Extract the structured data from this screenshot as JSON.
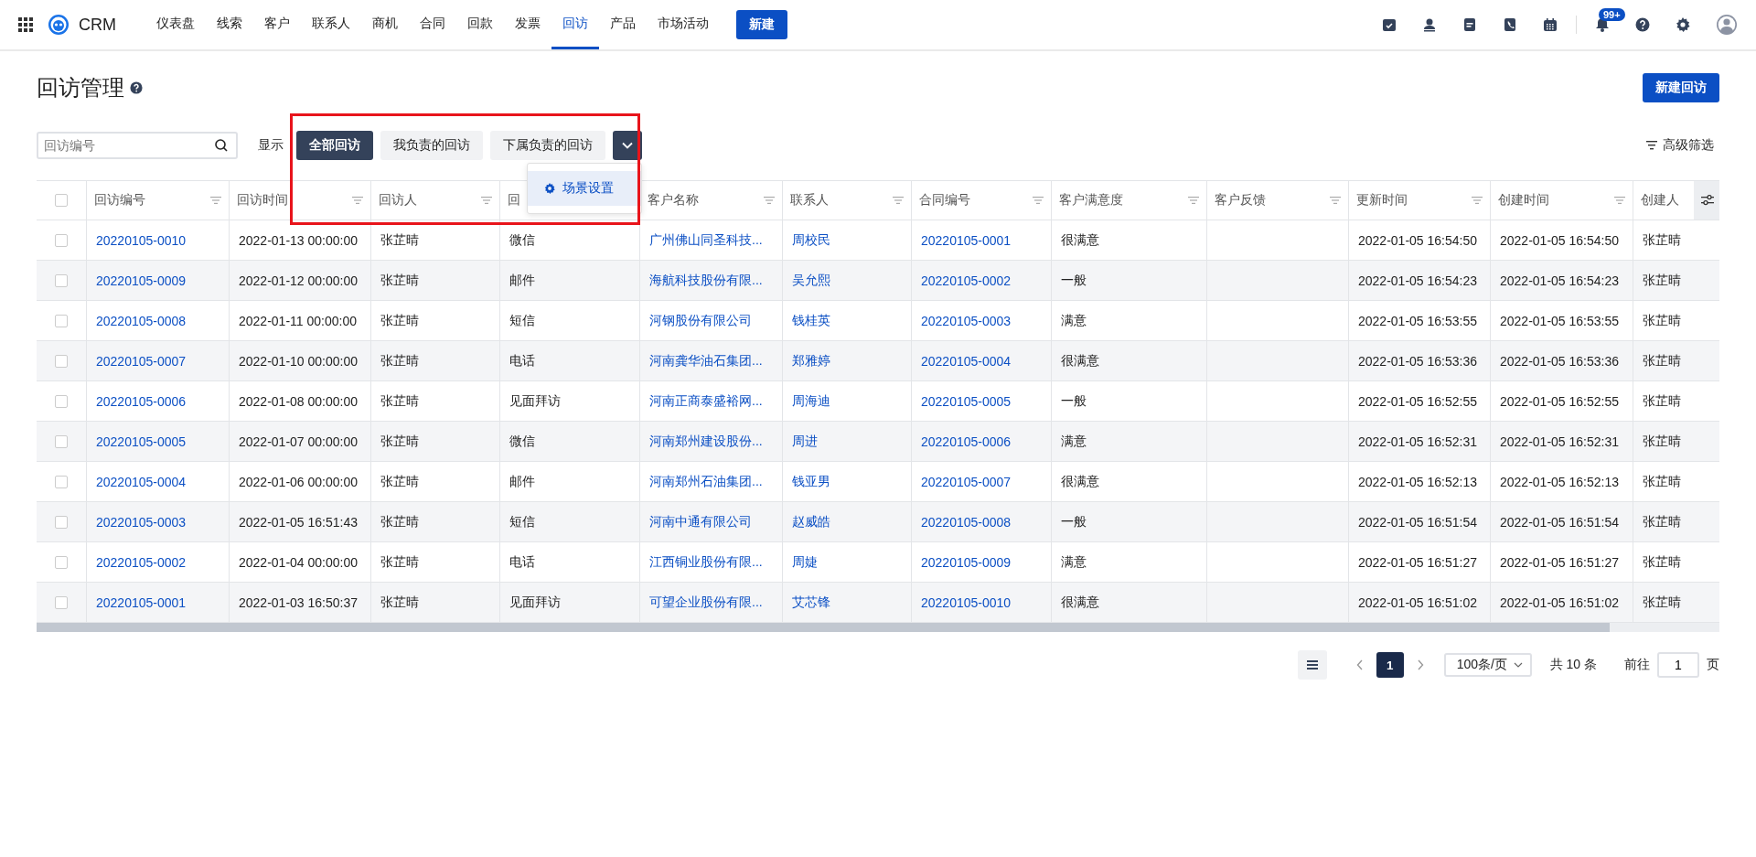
{
  "nav": {
    "brand": "CRM",
    "items": [
      {
        "label": "仪表盘",
        "selected": false
      },
      {
        "label": "线索",
        "selected": false
      },
      {
        "label": "客户",
        "selected": false
      },
      {
        "label": "联系人",
        "selected": false
      },
      {
        "label": "商机",
        "selected": false
      },
      {
        "label": "合同",
        "selected": false
      },
      {
        "label": "回款",
        "selected": false
      },
      {
        "label": "发票",
        "selected": false
      },
      {
        "label": "回访",
        "selected": true
      },
      {
        "label": "产品",
        "selected": false
      },
      {
        "label": "市场活动",
        "selected": false
      }
    ],
    "new_button": "新建",
    "badge": "99+"
  },
  "page": {
    "title": "回访管理",
    "new_button": "新建回访"
  },
  "toolbar": {
    "search": {
      "placeholder": "回访编号"
    },
    "show_label": "显示",
    "scenes": [
      {
        "label": "全部回访",
        "selected": true
      },
      {
        "label": "我负责的回访",
        "selected": false
      },
      {
        "label": "下属负责的回访",
        "selected": false
      }
    ],
    "filter": "高级筛选"
  },
  "dropdown": {
    "items": [
      "场景设置"
    ]
  },
  "table": {
    "select_all_checked": false,
    "columns": [
      {
        "label": "回访编号",
        "kind": "link"
      },
      {
        "label": "回访时间",
        "kind": "text"
      },
      {
        "label": "回访人",
        "kind": "text"
      },
      {
        "label": "回",
        "kind": "text"
      },
      {
        "label": "客户名称",
        "kind": "link"
      },
      {
        "label": "联系人",
        "kind": "link"
      },
      {
        "label": "合同编号",
        "kind": "link"
      },
      {
        "label": "客户满意度",
        "kind": "text"
      },
      {
        "label": "客户反馈"
      },
      {
        "label": "更新时间",
        "kind": "text"
      },
      {
        "label": "创建时间",
        "kind": "text"
      },
      {
        "label": "创建人",
        "kind": "text"
      }
    ],
    "rows": [
      {
        "checked": false,
        "cells": [
          "20220105-0010",
          "2022-01-13 00:00:00",
          "张芷晴",
          "微信",
          "广州佛山同圣科技...",
          "周校民",
          "20220105-0001",
          "很满意",
          "",
          "2022-01-05 16:54:50",
          "2022-01-05 16:54:50",
          "张芷晴"
        ]
      },
      {
        "checked": false,
        "cells": [
          "20220105-0009",
          "2022-01-12 00:00:00",
          "张芷晴",
          "邮件",
          "海航科技股份有限...",
          "吴允熙",
          "20220105-0002",
          "一般",
          "",
          "2022-01-05 16:54:23",
          "2022-01-05 16:54:23",
          "张芷晴"
        ]
      },
      {
        "checked": false,
        "cells": [
          "20220105-0008",
          "2022-01-11 00:00:00",
          "张芷晴",
          "短信",
          "河钢股份有限公司",
          "钱桂英",
          "20220105-0003",
          "满意",
          "",
          "2022-01-05 16:53:55",
          "2022-01-05 16:53:55",
          "张芷晴"
        ]
      },
      {
        "checked": false,
        "cells": [
          "20220105-0007",
          "2022-01-10 00:00:00",
          "张芷晴",
          "电话",
          "河南龚华油石集团...",
          "郑雅婷",
          "20220105-0004",
          "很满意",
          "",
          "2022-01-05 16:53:36",
          "2022-01-05 16:53:36",
          "张芷晴"
        ]
      },
      {
        "checked": false,
        "cells": [
          "20220105-0006",
          "2022-01-08 00:00:00",
          "张芷晴",
          "见面拜访",
          "河南正商泰盛裕网...",
          "周海迪",
          "20220105-0005",
          "一般",
          "",
          "2022-01-05 16:52:55",
          "2022-01-05 16:52:55",
          "张芷晴"
        ]
      },
      {
        "checked": false,
        "cells": [
          "20220105-0005",
          "2022-01-07 00:00:00",
          "张芷晴",
          "微信",
          "河南郑州建设股份...",
          "周进",
          "20220105-0006",
          "满意",
          "",
          "2022-01-05 16:52:31",
          "2022-01-05 16:52:31",
          "张芷晴"
        ]
      },
      {
        "checked": false,
        "cells": [
          "20220105-0004",
          "2022-01-06 00:00:00",
          "张芷晴",
          "邮件",
          "河南郑州石油集团...",
          "钱亚男",
          "20220105-0007",
          "很满意",
          "",
          "2022-01-05 16:52:13",
          "2022-01-05 16:52:13",
          "张芷晴"
        ]
      },
      {
        "checked": false,
        "cells": [
          "20220105-0003",
          "2022-01-05 16:51:43",
          "张芷晴",
          "短信",
          "河南中通有限公司",
          "赵威皓",
          "20220105-0008",
          "一般",
          "",
          "2022-01-05 16:51:54",
          "2022-01-05 16:51:54",
          "张芷晴"
        ]
      },
      {
        "checked": false,
        "cells": [
          "20220105-0002",
          "2022-01-04 00:00:00",
          "张芷晴",
          "电话",
          "江西铜业股份有限...",
          "周婕",
          "20220105-0009",
          "满意",
          "",
          "2022-01-05 16:51:27",
          "2022-01-05 16:51:27",
          "张芷晴"
        ]
      },
      {
        "checked": false,
        "cells": [
          "20220105-0001",
          "2022-01-03 16:50:37",
          "张芷晴",
          "见面拜访",
          "可望企业股份有限...",
          "艾芯锋",
          "20220105-0010",
          "很满意",
          "",
          "2022-01-05 16:51:02",
          "2022-01-05 16:51:02",
          "张芷晴"
        ]
      }
    ]
  },
  "pagination": {
    "pages": [
      {
        "label": "1",
        "selected": true
      }
    ],
    "page_size": "100条/页",
    "total": "共 10 条",
    "goto_label": "前往",
    "goto_value": "1",
    "page_suffix": "页"
  }
}
